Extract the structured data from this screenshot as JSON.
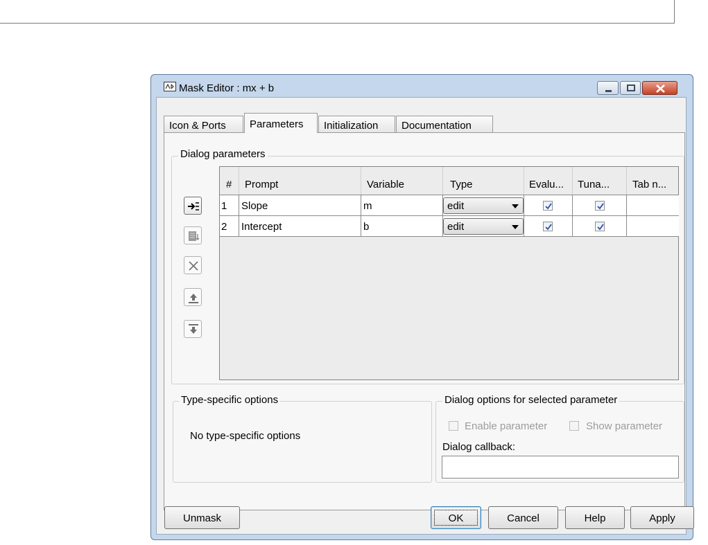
{
  "window": {
    "title": "Mask Editor : mx + b",
    "icon": "mask-editor-icon"
  },
  "tabs": [
    {
      "label": "Icon & Ports",
      "active": false
    },
    {
      "label": "Parameters",
      "active": true
    },
    {
      "label": "Initialization",
      "active": false
    },
    {
      "label": "Documentation",
      "active": false
    }
  ],
  "dialog_parameters": {
    "group_title": "Dialog parameters",
    "toolbar_icons": [
      "add-parameter-icon",
      "copy-parameter-icon",
      "delete-parameter-icon",
      "move-up-icon",
      "move-down-icon"
    ],
    "columns": [
      "#",
      "Prompt",
      "Variable",
      "Type",
      "Evalu...",
      "Tuna...",
      "Tab n..."
    ],
    "rows": [
      {
        "num": "1",
        "prompt": "Slope",
        "variable": "m",
        "type": "edit",
        "evaluate": true,
        "tunable": true,
        "tab_name": ""
      },
      {
        "num": "2",
        "prompt": "Intercept",
        "variable": "b",
        "type": "edit",
        "evaluate": true,
        "tunable": true,
        "tab_name": ""
      }
    ]
  },
  "type_specific": {
    "group_title": "Type-specific options",
    "message": "No type-specific options"
  },
  "dialog_options": {
    "group_title": "Dialog options for selected parameter",
    "enable_label": "Enable parameter",
    "show_label": "Show parameter",
    "callback_label": "Dialog callback:",
    "callback_value": ""
  },
  "buttons": {
    "unmask": "Unmask",
    "ok": "OK",
    "cancel": "Cancel",
    "help": "Help",
    "apply": "Apply"
  },
  "colors": {
    "title_bar": "#c5d7ec",
    "close_button": "#c34327",
    "check": "#3a5fa8"
  }
}
